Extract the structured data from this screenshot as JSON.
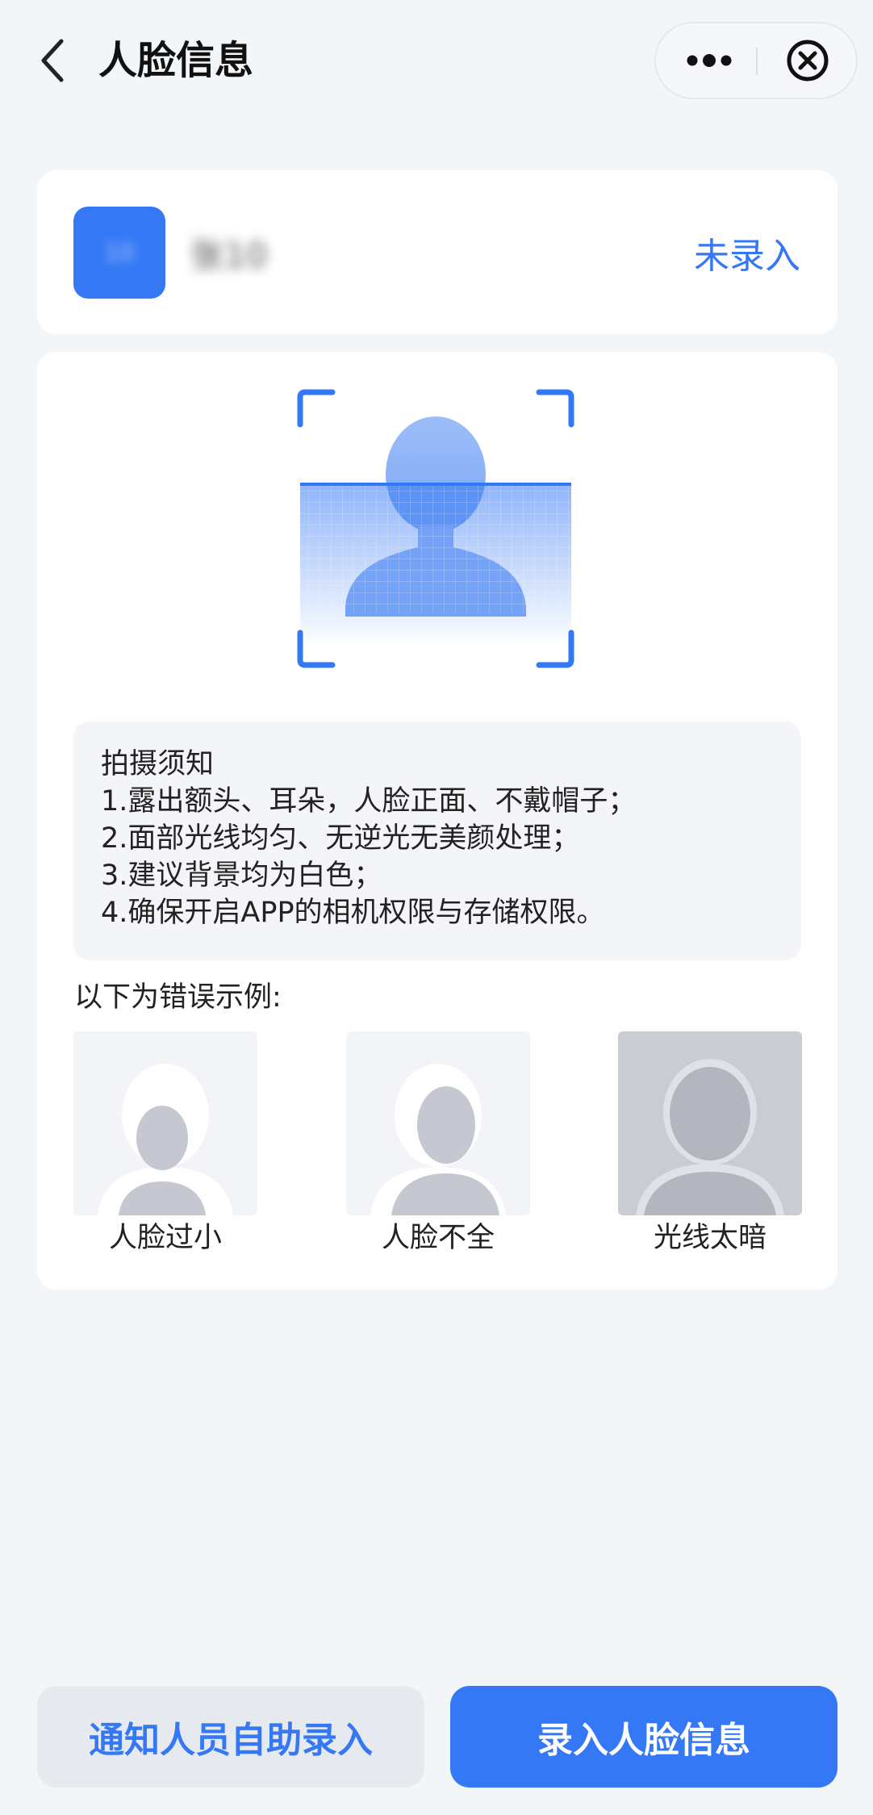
{
  "header": {
    "title": "人脸信息",
    "back_icon": "back-chevron-icon",
    "more_icon": "more-dots-icon",
    "close_icon": "close-circle-icon"
  },
  "user": {
    "avatar_text": "10",
    "name": "张10",
    "status": "未录入"
  },
  "colors": {
    "accent": "#3478f6",
    "background": "#f3f6f9",
    "card": "#ffffff",
    "tips_background": "#f3f5f9",
    "secondary_button": "#e6e9ee"
  },
  "tips": {
    "title": "拍摄须知",
    "items": [
      "1.露出额头、耳朵，人脸正面、不戴帽子；",
      "2.面部光线均匀、无逆光无美颜处理；",
      "3.建议背景均为白色；",
      "4.确保开启APP的相机权限与存储权限。"
    ]
  },
  "examples": {
    "title": "以下为错误示例:",
    "items": [
      {
        "label": "人脸过小"
      },
      {
        "label": "人脸不全"
      },
      {
        "label": "光线太暗"
      }
    ]
  },
  "buttons": {
    "notify": "通知人员自助录入",
    "enroll": "录入人脸信息"
  }
}
